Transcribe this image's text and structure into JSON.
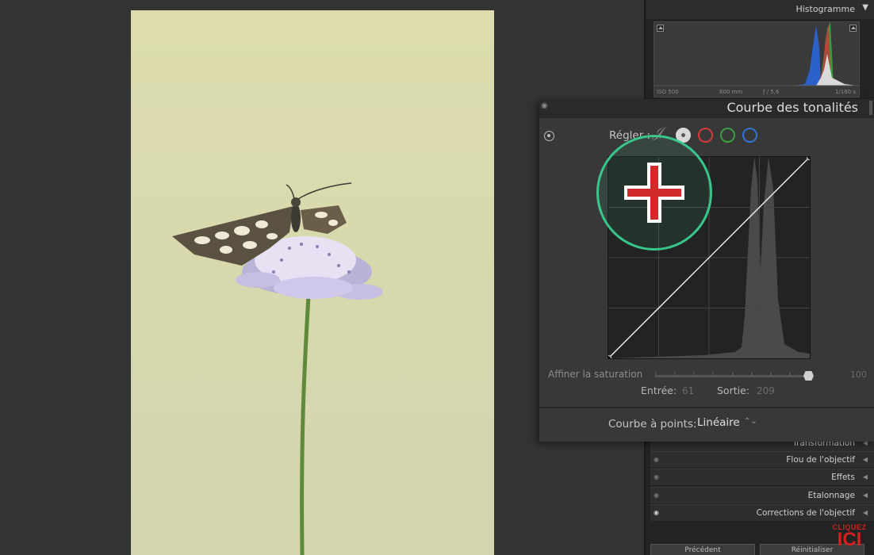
{
  "histogram": {
    "title": "Histogramme",
    "toggle_icon": "triangle-down",
    "exif": {
      "iso": "ISO 500",
      "focal": "800 mm",
      "aperture": "ƒ / 5,6",
      "shutter": "1/160 s"
    }
  },
  "tone_curve": {
    "title": "Courbe des tonalités",
    "regler_label": "Régler :",
    "channels": [
      "parametric",
      "rgb",
      "red",
      "green",
      "blue"
    ],
    "channel_colors": {
      "red": "#d43a3a",
      "green": "#3aa042",
      "blue": "#3473d2"
    },
    "saturation_label": "Affiner la saturation",
    "saturation_value": "100",
    "saturation_level": 1.0,
    "entree_label": "Entrée:",
    "entree_value": "61",
    "sortie_label": "Sortie:",
    "sortie_value": "209",
    "point_curve_label": "Courbe à points:",
    "point_curve_value": "Linéaire",
    "point_curve_arrows": "⌃⌄"
  },
  "panels": [
    {
      "label": "Transformation",
      "icon": "eye-icon"
    },
    {
      "label": "Flou de l'objectif",
      "icon": "eye-icon"
    },
    {
      "label": "Effets",
      "icon": "eye-icon"
    },
    {
      "label": "Etalonnage",
      "icon": "eye-icon"
    },
    {
      "label": "Corrections de l'objectif",
      "icon": "eye-icon"
    }
  ],
  "bottom_buttons": {
    "previous": "Précédent",
    "reset": "Réinitialiser"
  },
  "badge": {
    "small": "CLIQUEZ",
    "big": "ICI",
    "color": "#d61f1f"
  },
  "overlay": {
    "color": "#37c78b",
    "plus_color": "#d22a2a",
    "icon": "add-point-icon"
  }
}
